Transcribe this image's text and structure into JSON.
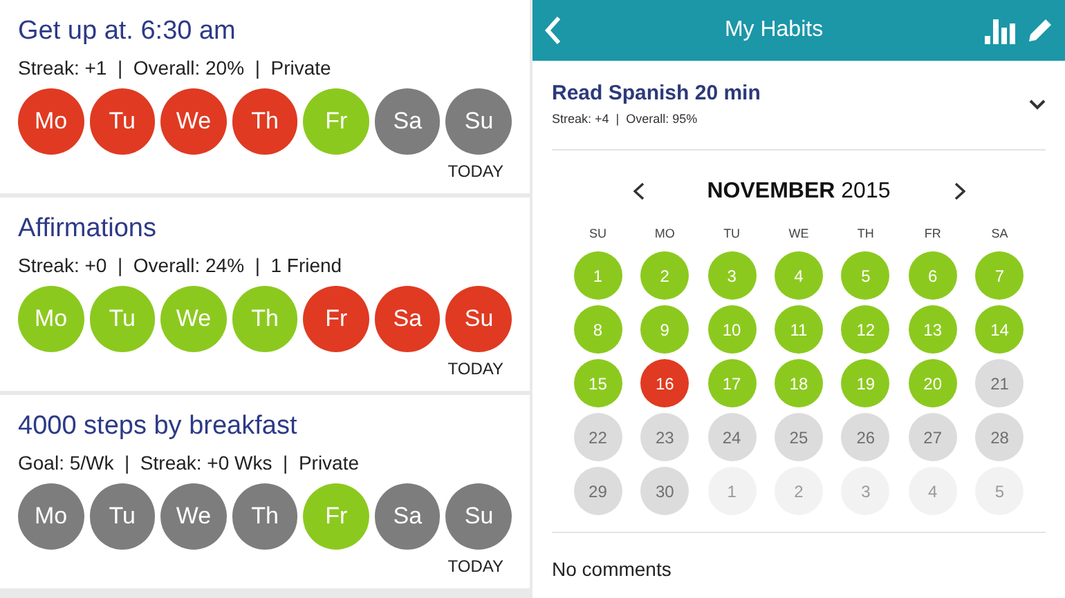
{
  "habits": [
    {
      "title": "Get up at. 6:30 am",
      "stats": "Streak: +1  |  Overall: 20%  |  Private",
      "today_label": "TODAY",
      "days": [
        {
          "label": "Mo",
          "done": false,
          "missed": true
        },
        {
          "label": "Tu",
          "done": false,
          "missed": true
        },
        {
          "label": "We",
          "done": false,
          "missed": true
        },
        {
          "label": "Th",
          "done": false,
          "missed": true
        },
        {
          "label": "Fr",
          "done": true,
          "missed": false
        },
        {
          "label": "Sa",
          "done": false,
          "missed": false
        },
        {
          "label": "Su",
          "done": false,
          "missed": false
        }
      ]
    },
    {
      "title": "Affirmations",
      "stats": "Streak: +0  |  Overall: 24%  |  1 Friend",
      "today_label": "TODAY",
      "days": [
        {
          "label": "Mo",
          "done": true,
          "missed": false
        },
        {
          "label": "Tu",
          "done": true,
          "missed": false
        },
        {
          "label": "We",
          "done": true,
          "missed": false
        },
        {
          "label": "Th",
          "done": true,
          "missed": false
        },
        {
          "label": "Fr",
          "done": false,
          "missed": true
        },
        {
          "label": "Sa",
          "done": false,
          "missed": true
        },
        {
          "label": "Su",
          "done": false,
          "missed": true
        }
      ]
    },
    {
      "title": "4000 steps by breakfast",
      "stats": "Goal: 5/Wk  |  Streak: +0 Wks  |  Private",
      "today_label": "TODAY",
      "days": [
        {
          "label": "Mo",
          "done": false,
          "missed": false
        },
        {
          "label": "Tu",
          "done": false,
          "missed": false
        },
        {
          "label": "We",
          "done": false,
          "missed": false
        },
        {
          "label": "Th",
          "done": false,
          "missed": false
        },
        {
          "label": "Fr",
          "done": true,
          "missed": false
        },
        {
          "label": "Sa",
          "done": false,
          "missed": false
        },
        {
          "label": "Su",
          "done": false,
          "missed": false
        }
      ]
    }
  ],
  "detail": {
    "header_title": "My Habits",
    "habit_title": "Read Spanish 20 min",
    "habit_stats": "Streak: +4  |  Overall: 95%",
    "month": "NOVEMBER",
    "year": "2015",
    "weekdays": [
      "SU",
      "MO",
      "TU",
      "WE",
      "TH",
      "FR",
      "SA"
    ],
    "days": [
      {
        "label": "1",
        "done": true,
        "missed": false,
        "in_month": true
      },
      {
        "label": "2",
        "done": true,
        "missed": false,
        "in_month": true
      },
      {
        "label": "3",
        "done": true,
        "missed": false,
        "in_month": true
      },
      {
        "label": "4",
        "done": true,
        "missed": false,
        "in_month": true
      },
      {
        "label": "5",
        "done": true,
        "missed": false,
        "in_month": true
      },
      {
        "label": "6",
        "done": true,
        "missed": false,
        "in_month": true
      },
      {
        "label": "7",
        "done": true,
        "missed": false,
        "in_month": true
      },
      {
        "label": "8",
        "done": true,
        "missed": false,
        "in_month": true
      },
      {
        "label": "9",
        "done": true,
        "missed": false,
        "in_month": true
      },
      {
        "label": "10",
        "done": true,
        "missed": false,
        "in_month": true
      },
      {
        "label": "11",
        "done": true,
        "missed": false,
        "in_month": true
      },
      {
        "label": "12",
        "done": true,
        "missed": false,
        "in_month": true
      },
      {
        "label": "13",
        "done": true,
        "missed": false,
        "in_month": true
      },
      {
        "label": "14",
        "done": true,
        "missed": false,
        "in_month": true
      },
      {
        "label": "15",
        "done": true,
        "missed": false,
        "in_month": true
      },
      {
        "label": "16",
        "done": false,
        "missed": true,
        "in_month": true
      },
      {
        "label": "17",
        "done": true,
        "missed": false,
        "in_month": true
      },
      {
        "label": "18",
        "done": true,
        "missed": false,
        "in_month": true
      },
      {
        "label": "19",
        "done": true,
        "missed": false,
        "in_month": true
      },
      {
        "label": "20",
        "done": true,
        "missed": false,
        "in_month": true
      },
      {
        "label": "21",
        "done": false,
        "missed": false,
        "in_month": true
      },
      {
        "label": "22",
        "done": false,
        "missed": false,
        "in_month": true
      },
      {
        "label": "23",
        "done": false,
        "missed": false,
        "in_month": true
      },
      {
        "label": "24",
        "done": false,
        "missed": false,
        "in_month": true
      },
      {
        "label": "25",
        "done": false,
        "missed": false,
        "in_month": true
      },
      {
        "label": "26",
        "done": false,
        "missed": false,
        "in_month": true
      },
      {
        "label": "27",
        "done": false,
        "missed": false,
        "in_month": true
      },
      {
        "label": "28",
        "done": false,
        "missed": false,
        "in_month": true
      },
      {
        "label": "29",
        "done": false,
        "missed": false,
        "in_month": true
      },
      {
        "label": "30",
        "done": false,
        "missed": false,
        "in_month": true
      },
      {
        "label": "1",
        "in_month": false
      },
      {
        "label": "2",
        "in_month": false
      },
      {
        "label": "3",
        "in_month": false
      },
      {
        "label": "4",
        "in_month": false
      },
      {
        "label": "5",
        "in_month": false
      }
    ],
    "comments": "No comments"
  }
}
